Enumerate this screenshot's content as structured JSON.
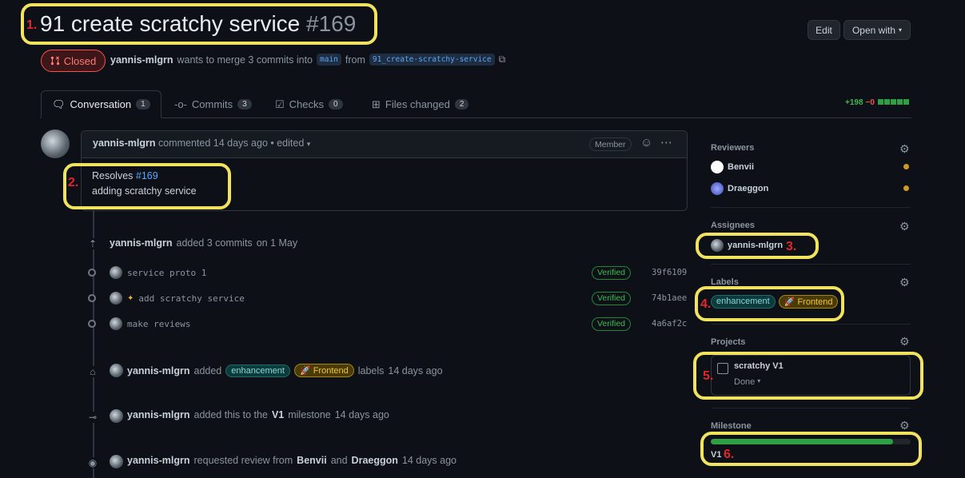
{
  "annotations": [
    "1.",
    "2.",
    "3.",
    "4.",
    "5.",
    "6."
  ],
  "pr": {
    "title": "91 create scratchy service",
    "number": "#169",
    "state": "Closed",
    "author": "yannis-mlgrn",
    "merge_text": "wants to merge 3 commits into",
    "base_branch": "main",
    "from_text": "from",
    "head_branch": "91_create-scratchy-service"
  },
  "header": {
    "edit_label": "Edit",
    "open_with_label": "Open with"
  },
  "tabs": [
    {
      "label": "Conversation",
      "count": "1"
    },
    {
      "label": "Commits",
      "count": "3"
    },
    {
      "label": "Checks",
      "count": "0"
    },
    {
      "label": "Files changed",
      "count": "2"
    }
  ],
  "diffstat": {
    "additions": "+198",
    "deletions": "−0"
  },
  "comment": {
    "author": "yannis-mlgrn",
    "action": "commented",
    "time": "14 days ago",
    "edited": "• edited",
    "role": "Member",
    "body_prefix": "Resolves",
    "body_ref": "#169",
    "body_line2": "adding scratchy service"
  },
  "events": {
    "commits_added": {
      "author": "yannis-mlgrn",
      "text": "added 3 commits",
      "date": "on 1 May"
    },
    "commits": [
      {
        "message": "service proto 1",
        "badge": "Verified",
        "sha": "39f6109"
      },
      {
        "message": "add scratchy service",
        "badge": "Verified",
        "sha": "74b1aee"
      },
      {
        "message": "make reviews",
        "badge": "Verified",
        "sha": "4a6af2c"
      }
    ],
    "labels_added": {
      "author": "yannis-mlgrn",
      "action": "added",
      "suffix": "labels",
      "time": "14 days ago"
    },
    "milestone_added": {
      "author": "yannis-mlgrn",
      "text": "added this to the",
      "milestone": "V1",
      "suffix": "milestone",
      "time": "14 days ago"
    },
    "review_requested": {
      "author": "yannis-mlgrn",
      "text": "requested review from",
      "r1": "Benvii",
      "and": "and",
      "r2": "Draeggon",
      "time": "14 days ago"
    }
  },
  "sidebar": {
    "reviewers_heading": "Reviewers",
    "reviewers": [
      "Benvii",
      "Draeggon"
    ],
    "assignees_heading": "Assignees",
    "assignee": "yannis-mlgrn",
    "labels_heading": "Labels",
    "labels": [
      "enhancement",
      "Frontend"
    ],
    "projects_heading": "Projects",
    "project_name": "scratchy V1",
    "project_status": "Done",
    "milestone_heading": "Milestone",
    "milestone_name": "V1",
    "milestone_progress": 0.91
  },
  "colors": {
    "accent": "#58a6ff",
    "closed": "#f85149",
    "success": "#3fb950",
    "highlight": "#f2e35e",
    "annotation": "#e3262b"
  }
}
